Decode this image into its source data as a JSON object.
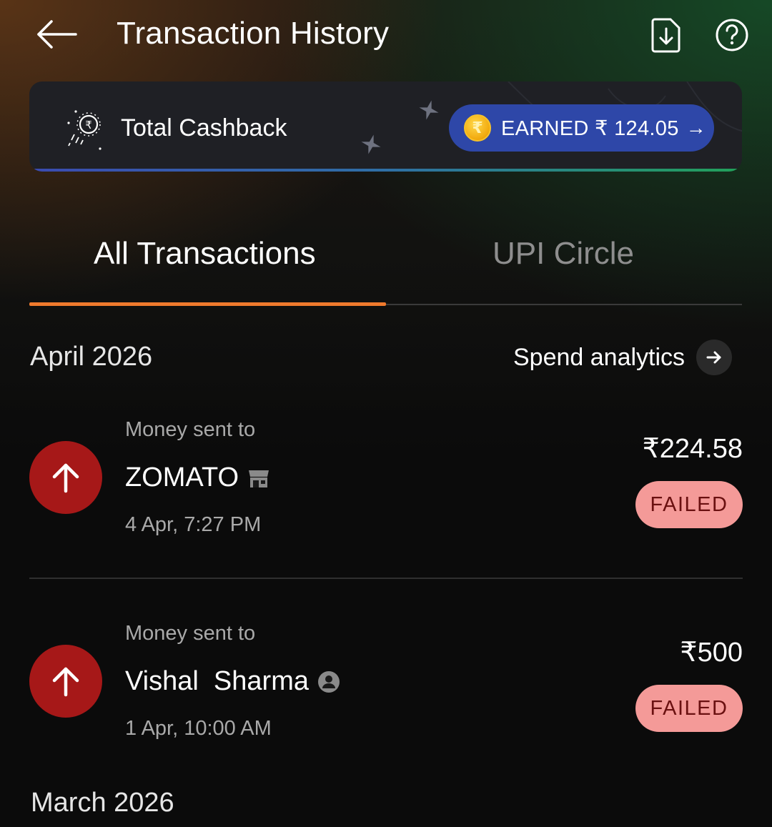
{
  "header": {
    "title": "Transaction History",
    "back_icon": "arrow-left-icon",
    "download_icon": "download-file-icon",
    "help_icon": "question-circle-icon"
  },
  "cashback": {
    "label": "Total Cashback",
    "earned_label": "EARNED ₹ 124.05",
    "coin_symbol": "₹",
    "arrow": "→"
  },
  "tabs": [
    {
      "label": "All Transactions",
      "active": true
    },
    {
      "label": "UPI Circle",
      "active": false
    }
  ],
  "sections": [
    {
      "title": "April 2026",
      "action_label": "Spend analytics",
      "transactions": [
        {
          "subtitle": "Money sent to",
          "name": "ZOMATO",
          "name_icon": "store-icon",
          "time": "4 Apr, 7:27 PM",
          "amount": "₹224.58",
          "status": "FAILED"
        },
        {
          "subtitle": "Money sent to",
          "name": "Vishal  Sharma",
          "name_icon": "person-icon",
          "time": "1 Apr, 10:00 AM",
          "amount": "₹500",
          "status": "FAILED"
        }
      ]
    },
    {
      "title": "March 2026"
    }
  ],
  "colors": {
    "accent_tab": "#ef7a2d",
    "earned_pill": "#2e47a8",
    "txn_icon_bg": "#a61818",
    "status_failed_bg": "#f49a98",
    "status_failed_text": "#6a1010"
  }
}
